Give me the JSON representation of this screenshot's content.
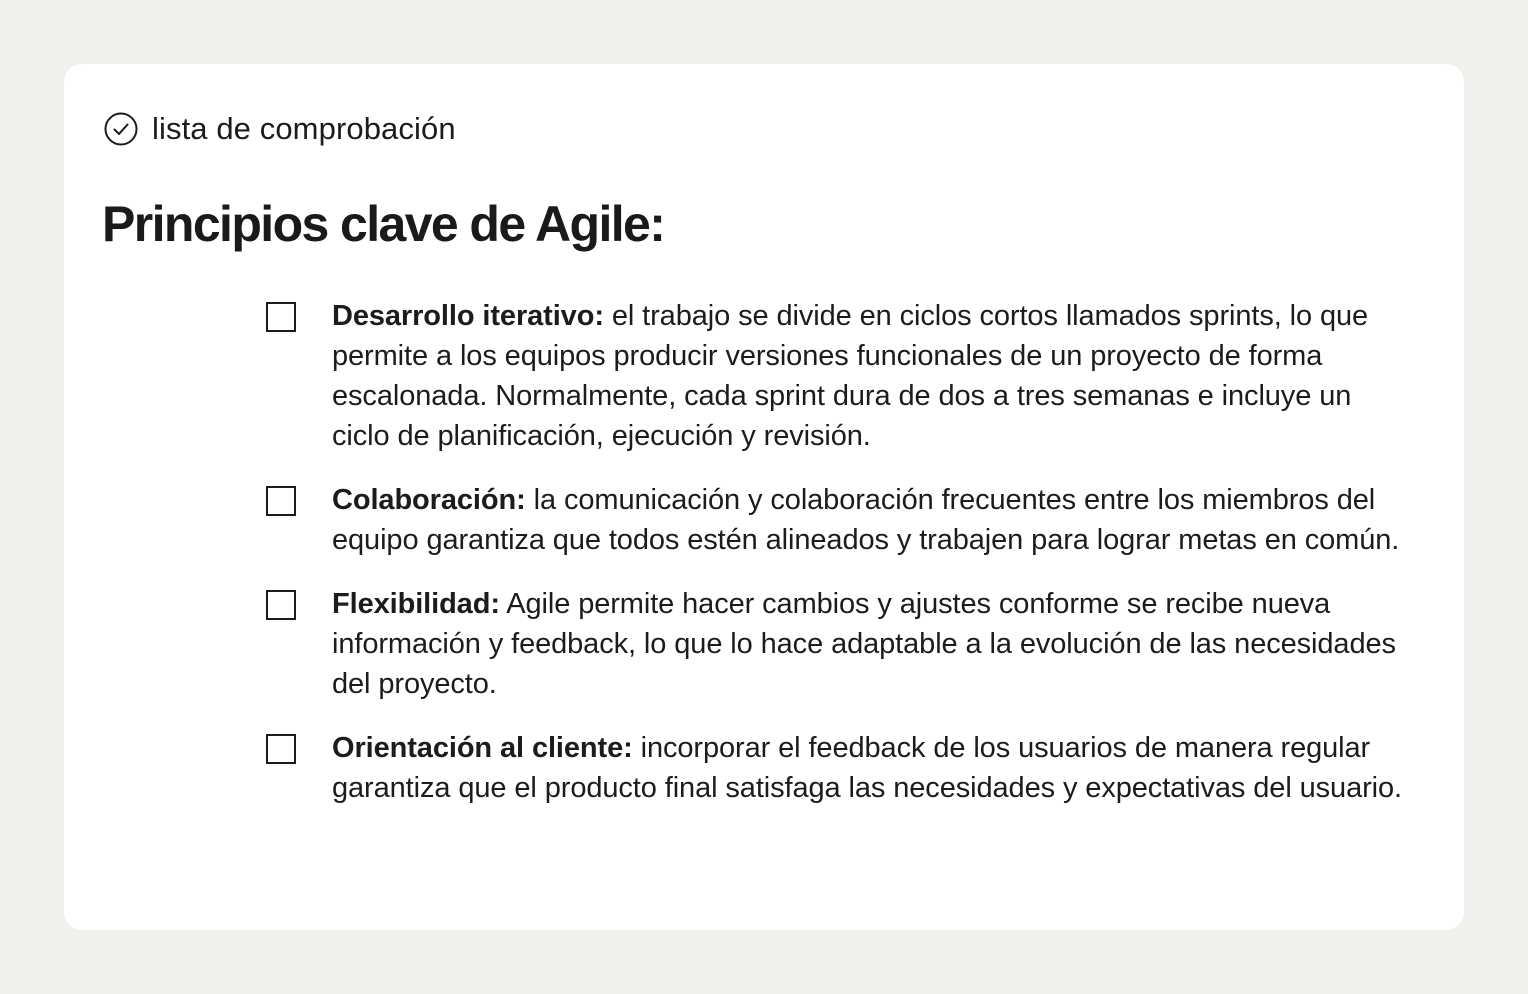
{
  "header": {
    "icon": "check-circle-icon",
    "label": "lista de comprobación"
  },
  "title": "Principios clave de Agile:",
  "items": [
    {
      "term": "Desarrollo iterativo:",
      "text": " el trabajo se divide en ciclos cortos llamados sprints, lo que permite a los equipos producir versiones funcionales de un proyecto de forma escalonada. Normalmente, cada sprint dura de dos a tres semanas e incluye un ciclo de planificación, ejecución y revisión.",
      "checked": false
    },
    {
      "term": "Colaboración:",
      "text": " la comunicación y colaboración frecuentes entre los miembros del equipo garantiza que todos estén alineados y trabajen para lograr metas en común.",
      "checked": false
    },
    {
      "term": "Flexibilidad:",
      "text": " Agile permite hacer cambios y ajustes conforme se recibe nueva información y feedback, lo que lo hace adaptable a la evolución de las necesidades del proyecto.",
      "checked": false
    },
    {
      "term": "Orientación al cliente:",
      "text": " incorporar el feedback de los usuarios de manera regular garantiza que el producto final satisfaga las necesidades y expectativas del usuario.",
      "checked": false
    }
  ],
  "colors": {
    "background": "#f1f0ed",
    "card": "#ffffff",
    "text": "#1c1c1c"
  }
}
